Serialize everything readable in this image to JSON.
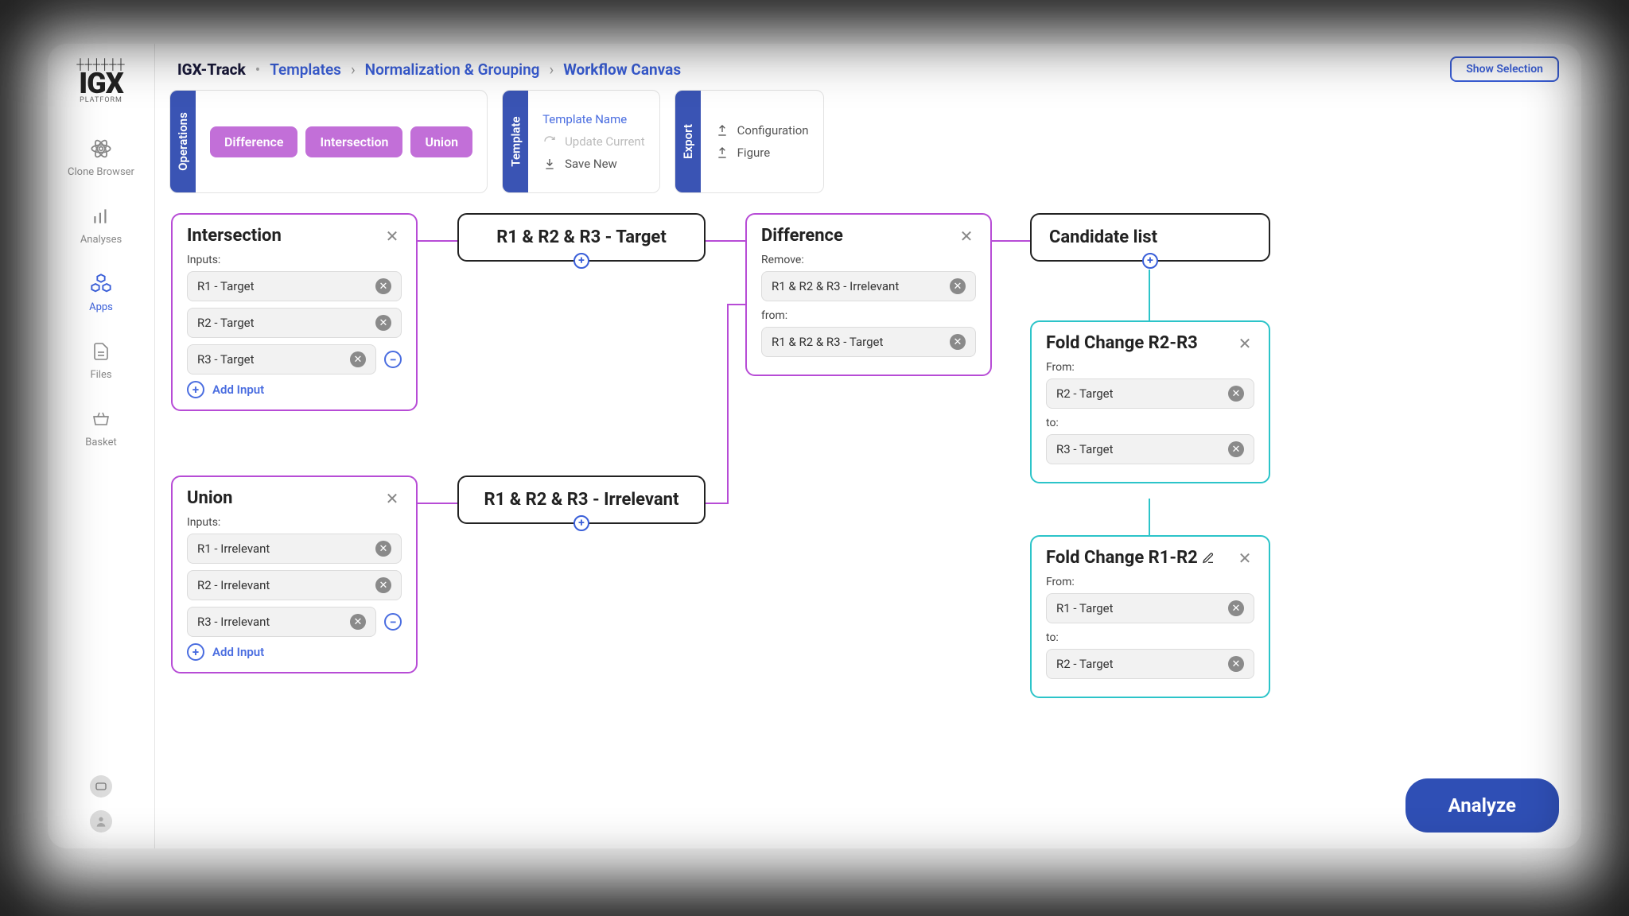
{
  "breadcrumb": {
    "app": "IGX-Track",
    "templates": "Templates",
    "norm": "Normalization & Grouping",
    "current": "Workflow Canvas"
  },
  "buttons": {
    "show_selection": "Show Selection",
    "analyze": "Analyze"
  },
  "sidebar": {
    "logo_text": "IGX",
    "logo_sub": "PLATFORM",
    "items": [
      {
        "label": "Clone Browser"
      },
      {
        "label": "Analyses"
      },
      {
        "label": "Apps"
      },
      {
        "label": "Files"
      },
      {
        "label": "Basket"
      }
    ]
  },
  "toolbar": {
    "operations_tab": "Operations",
    "ops": {
      "difference": "Difference",
      "intersection": "Intersection",
      "union": "Union"
    },
    "template_tab": "Template",
    "template": {
      "name": "Template Name",
      "update": "Update Current",
      "save": "Save New"
    },
    "export_tab": "Export",
    "export": {
      "config": "Configuration",
      "figure": "Figure"
    }
  },
  "nodes": {
    "intersection": {
      "title": "Intersection",
      "inputs_label": "Inputs:",
      "inputs": [
        "R1 - Target",
        "R2 - Target",
        "R3 - Target"
      ],
      "add": "Add Input"
    },
    "union": {
      "title": "Union",
      "inputs_label": "Inputs:",
      "inputs": [
        "R1 - Irrelevant",
        "R2 - Irrelevant",
        "R3 - Irrelevant"
      ],
      "add": "Add Input"
    },
    "difference": {
      "title": "Difference",
      "remove_label": "Remove:",
      "remove_value": "R1 & R2 & R3 - Irrelevant",
      "from_label": "from:",
      "from_value": "R1 & R2 & R3 - Target"
    },
    "result_target": "R1 & R2 & R3 - Target",
    "result_irrelevant": "R1 & R2 & R3 - Irrelevant",
    "candidate": "Candidate list",
    "fc1": {
      "title": "Fold Change R2-R3",
      "from_label": "From:",
      "from_value": "R2 - Target",
      "to_label": "to:",
      "to_value": "R3 - Target"
    },
    "fc2": {
      "title": "Fold Change R1-R2",
      "from_label": "From:",
      "from_value": "R1 - Target",
      "to_label": "to:",
      "to_value": "R2 - Target"
    }
  }
}
